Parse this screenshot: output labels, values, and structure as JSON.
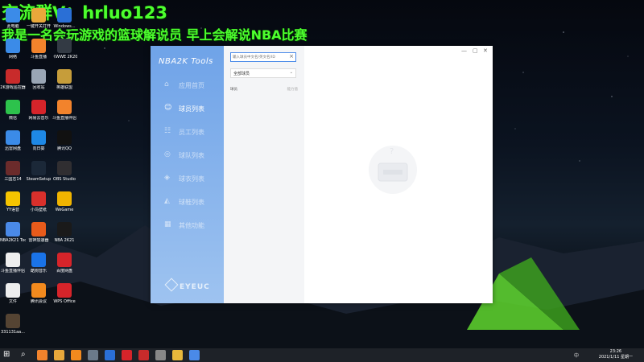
{
  "overlay": {
    "line1": "交流群V：hrluo123",
    "line2": "我是一名会玩游戏的篮球解说员 早上会解说NBA比赛"
  },
  "desktop_icons": [
    {
      "label": "此电脑",
      "color": "#3b8be8"
    },
    {
      "label": "一键开关打开",
      "color": "#e8a83b"
    },
    {
      "label": "Windows...",
      "color": "#2a6fd6"
    },
    {
      "label": "网络",
      "color": "#3b8be8"
    },
    {
      "label": "斗鱼直播",
      "color": "#f2832c"
    },
    {
      "label": "《WWE 2K20》3D...",
      "color": "#333a44"
    },
    {
      "label": "2K游戏遥控器",
      "color": "#c82b2b"
    },
    {
      "label": "回收站",
      "color": "#9aa6b5"
    },
    {
      "label": "英雄联盟",
      "color": "#c69d3a"
    },
    {
      "label": "微信",
      "color": "#2dc24c"
    },
    {
      "label": "网易云音乐",
      "color": "#d6242a"
    },
    {
      "label": "斗鱼直播伴侣",
      "color": "#f2832c"
    },
    {
      "label": "迅雷网盘",
      "color": "#3b8be8"
    },
    {
      "label": "向日葵",
      "color": "#1e88e5"
    },
    {
      "label": "腾讯QQ",
      "color": "#111111"
    },
    {
      "label": "三国志14",
      "color": "#6b2b2b"
    },
    {
      "label": "SteamSetup",
      "color": "#1b2838"
    },
    {
      "label": "OBS Studio",
      "color": "#302e31"
    },
    {
      "label": "YY语音",
      "color": "#f5c400"
    },
    {
      "label": "小鸟壁纸",
      "color": "#d9302c"
    },
    {
      "label": "WeGame",
      "color": "#f0b400"
    },
    {
      "label": "NBA2K21 Tools",
      "color": "#4a8ae8"
    },
    {
      "label": "雷神加速器",
      "color": "#e85b1b"
    },
    {
      "label": "NBA 2K21",
      "color": "#1a1a1a"
    },
    {
      "label": "斗鱼直播伴侣",
      "color": "#eeeeee"
    },
    {
      "label": "酷狗音乐",
      "color": "#1a73e8"
    },
    {
      "label": "百度网盘",
      "color": "#d6242a"
    },
    {
      "label": "文件",
      "color": "#eeeeee"
    },
    {
      "label": "腾讯会议",
      "color": "#f28a1e"
    },
    {
      "label": "WPS Office",
      "color": "#d6242a"
    },
    {
      "label": "331131aa...",
      "color": "#554433"
    }
  ],
  "app": {
    "title": "NBA2K Tools",
    "nav": [
      {
        "label": "应用首页",
        "icon": "home-icon",
        "glyph": "⌂"
      },
      {
        "label": "球员列表",
        "icon": "user-icon",
        "glyph": "☺"
      },
      {
        "label": "员工列表",
        "icon": "staff-icon",
        "glyph": "☷"
      },
      {
        "label": "球队列表",
        "icon": "team-icon",
        "glyph": "◎"
      },
      {
        "label": "球衣列表",
        "icon": "jersey-icon",
        "glyph": "◈"
      },
      {
        "label": "球鞋列表",
        "icon": "shoe-icon",
        "glyph": "◭"
      },
      {
        "label": "其他功能",
        "icon": "grid-icon",
        "glyph": "▦"
      }
    ],
    "active_nav": 1,
    "brand": "EYEUC",
    "search_placeholder": "输入球员中文名/英文名/ID",
    "dropdown_value": "全部球员",
    "col_left": "球员",
    "col_right": "能力值",
    "accent": "#4a8ae8"
  },
  "taskbar": {
    "time": "23:26",
    "date": "2021/1/11 星期一",
    "tray_lang": "中"
  }
}
